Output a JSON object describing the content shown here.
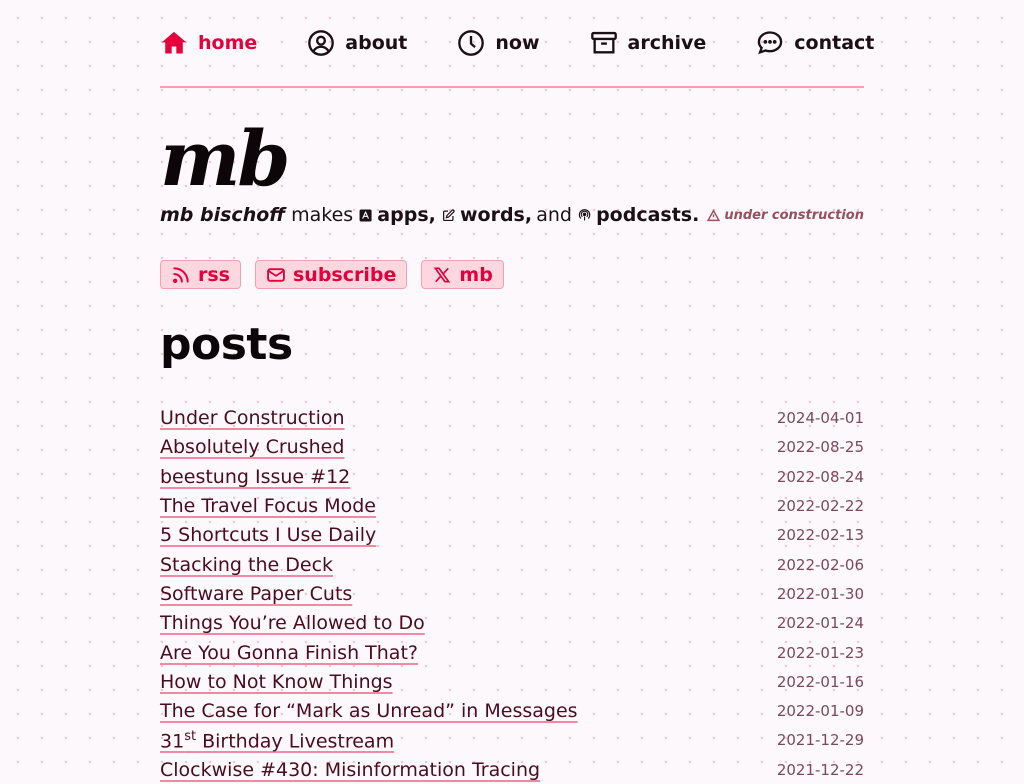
{
  "nav": [
    {
      "label": "home",
      "icon": "home-icon",
      "active": true
    },
    {
      "label": "about",
      "icon": "user-circle-icon",
      "active": false
    },
    {
      "label": "now",
      "icon": "clock-icon",
      "active": false
    },
    {
      "label": "archive",
      "icon": "archive-box-icon",
      "active": false
    },
    {
      "label": "contact",
      "icon": "chat-bubble-icon",
      "active": false
    }
  ],
  "header": {
    "title": "mb",
    "author": "mb bischoff",
    "makes": "makes",
    "apps": "apps,",
    "words": "words,",
    "and": "and",
    "podcasts": "podcasts.",
    "status": "under construction"
  },
  "links": {
    "rss": "rss",
    "subscribe": "subscribe",
    "x": "mb"
  },
  "posts_title": "posts",
  "posts": [
    {
      "title": "Under Construction",
      "date": "2024-04-01"
    },
    {
      "title": "Absolutely Crushed",
      "date": "2022-08-25"
    },
    {
      "title": "beestung Issue #12",
      "date": "2022-08-24"
    },
    {
      "title": "The Travel Focus Mode",
      "date": "2022-02-22"
    },
    {
      "title": "5 Shortcuts I Use Daily",
      "date": "2022-02-13"
    },
    {
      "title": "Stacking the Deck",
      "date": "2022-02-06"
    },
    {
      "title": "Software Paper Cuts",
      "date": "2022-01-30"
    },
    {
      "title": "Things You’re Allowed to Do",
      "date": "2022-01-24"
    },
    {
      "title": "Are You Gonna Finish That?",
      "date": "2022-01-23"
    },
    {
      "title": "How to Not Know Things",
      "date": "2022-01-16"
    },
    {
      "title": "The Case for “Mark as Unread” in Messages",
      "date": "2022-01-09"
    },
    {
      "title": "31st Birthday Livestream",
      "date": "2021-12-29"
    },
    {
      "title": "Clockwise #430: Misinformation Tracing",
      "date": "2021-12-22"
    }
  ],
  "colors": {
    "accent": "#e5003b",
    "link": "#4a0d1e",
    "underline": "#f08aa4",
    "pill_bg": "#fcd7e0",
    "background": "#fdf8fb"
  }
}
